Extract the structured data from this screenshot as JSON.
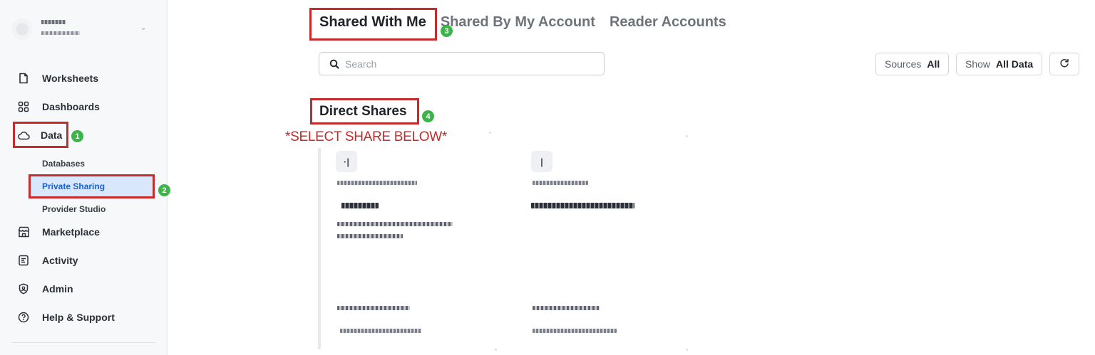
{
  "sidebar": {
    "nav": [
      {
        "label": "Worksheets",
        "icon": "worksheet-icon"
      },
      {
        "label": "Dashboards",
        "icon": "dashboards-icon"
      },
      {
        "label": "Data",
        "icon": "cloud-icon"
      },
      {
        "label": "Marketplace",
        "icon": "storefront-icon"
      },
      {
        "label": "Activity",
        "icon": "activity-icon"
      },
      {
        "label": "Admin",
        "icon": "shield-icon"
      },
      {
        "label": "Help & Support",
        "icon": "help-icon"
      }
    ],
    "data_sub": [
      {
        "label": "Databases"
      },
      {
        "label": "Private Sharing"
      },
      {
        "label": "Provider Studio"
      }
    ]
  },
  "tabs": [
    {
      "label": "Shared With Me"
    },
    {
      "label": "Shared By My Account"
    },
    {
      "label": "Reader Accounts"
    }
  ],
  "search": {
    "placeholder": "Search",
    "value": ""
  },
  "filters": {
    "sources": {
      "key": "Sources",
      "value": "All"
    },
    "show": {
      "key": "Show",
      "value": "All Data"
    }
  },
  "section_title": "Direct Shares",
  "annotation_note": "*SELECT SHARE BELOW*",
  "badges": [
    "1",
    "2",
    "3",
    "4"
  ],
  "colors": {
    "annotation_red": "#c42b2b",
    "badge_green": "#3bb44a",
    "active_sub_bg": "#d8e7fb",
    "active_sub_text": "#1a5fd6"
  }
}
